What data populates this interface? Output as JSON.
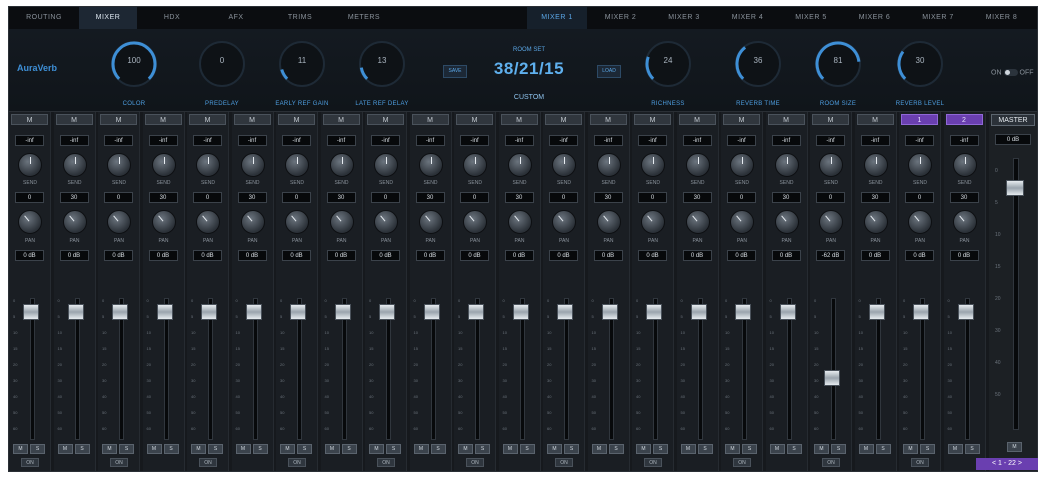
{
  "tabs": [
    "ROUTING",
    "MIXER",
    "HDX",
    "AFX",
    "TRIMS",
    "METERS"
  ],
  "active_tab": 1,
  "mixer_tabs": [
    "MIXER 1",
    "MIXER 2",
    "MIXER 3",
    "MIXER 4",
    "MIXER 5",
    "MIXER 6",
    "MIXER 7",
    "MIXER 8"
  ],
  "active_mixer_tab": 0,
  "reverb": {
    "logo": "AuraVerb",
    "knobs": [
      {
        "value": "100",
        "label": "COLOR"
      },
      {
        "value": "0",
        "label": "PREDELAY"
      },
      {
        "value": "11",
        "label": "EARLY REF GAIN"
      },
      {
        "value": "13",
        "label": "LATE REF DELAY"
      },
      {
        "value": "24",
        "label": "RICHNESS"
      },
      {
        "value": "36",
        "label": "REVERB TIME"
      },
      {
        "value": "81",
        "label": "ROOM SIZE"
      },
      {
        "value": "30",
        "label": "REVERB LEVEL"
      }
    ],
    "save_label": "SAVE",
    "load_label": "LOAD",
    "room_title": "ROOM SET",
    "room_value": "38/21/15",
    "preset": "CUSTOM",
    "onoff_on": "ON",
    "onoff_off": "OFF"
  },
  "channels": [
    {
      "header": "M",
      "level": "-inf",
      "send_label": "SEND",
      "send": "0",
      "pan_label": "PAN",
      "gain": "0 dB",
      "fader": 0.1,
      "btn1": "M",
      "btn2": "S",
      "footer": "ON"
    },
    {
      "header": "M",
      "level": "-inf",
      "send_label": "SEND",
      "send": "30",
      "pan_label": "PAN",
      "gain": "0 dB",
      "fader": 0.1,
      "btn1": "M",
      "btn2": "S",
      "footer": ""
    },
    {
      "header": "M",
      "level": "-inf",
      "send_label": "SEND",
      "send": "0",
      "pan_label": "PAN",
      "gain": "0 dB",
      "fader": 0.1,
      "btn1": "M",
      "btn2": "S",
      "footer": "ON"
    },
    {
      "header": "M",
      "level": "-inf",
      "send_label": "SEND",
      "send": "30",
      "pan_label": "PAN",
      "gain": "0 dB",
      "fader": 0.1,
      "btn1": "M",
      "btn2": "S",
      "footer": ""
    },
    {
      "header": "M",
      "level": "-inf",
      "send_label": "SEND",
      "send": "0",
      "pan_label": "PAN",
      "gain": "0 dB",
      "fader": 0.1,
      "btn1": "M",
      "btn2": "S",
      "footer": "ON"
    },
    {
      "header": "M",
      "level": "-inf",
      "send_label": "SEND",
      "send": "30",
      "pan_label": "PAN",
      "gain": "0 dB",
      "fader": 0.1,
      "btn1": "M",
      "btn2": "S",
      "footer": ""
    },
    {
      "header": "M",
      "level": "-inf",
      "send_label": "SEND",
      "send": "0",
      "pan_label": "PAN",
      "gain": "0 dB",
      "fader": 0.1,
      "btn1": "M",
      "btn2": "S",
      "footer": "ON"
    },
    {
      "header": "M",
      "level": "-inf",
      "send_label": "SEND",
      "send": "30",
      "pan_label": "PAN",
      "gain": "0 dB",
      "fader": 0.1,
      "btn1": "M",
      "btn2": "S",
      "footer": ""
    },
    {
      "header": "M",
      "level": "-inf",
      "send_label": "SEND",
      "send": "0",
      "pan_label": "PAN",
      "gain": "0 dB",
      "fader": 0.1,
      "btn1": "M",
      "btn2": "S",
      "footer": "ON"
    },
    {
      "header": "M",
      "level": "-inf",
      "send_label": "SEND",
      "send": "30",
      "pan_label": "PAN",
      "gain": "0 dB",
      "fader": 0.1,
      "btn1": "M",
      "btn2": "S",
      "footer": ""
    },
    {
      "header": "M",
      "level": "-inf",
      "send_label": "SEND",
      "send": "0",
      "pan_label": "PAN",
      "gain": "0 dB",
      "fader": 0.1,
      "btn1": "M",
      "btn2": "S",
      "footer": "ON"
    },
    {
      "header": "M",
      "level": "-inf",
      "send_label": "SEND",
      "send": "30",
      "pan_label": "PAN",
      "gain": "0 dB",
      "fader": 0.1,
      "btn1": "M",
      "btn2": "S",
      "footer": ""
    },
    {
      "header": "M",
      "level": "-inf",
      "send_label": "SEND",
      "send": "0",
      "pan_label": "PAN",
      "gain": "0 dB",
      "fader": 0.1,
      "btn1": "M",
      "btn2": "S",
      "footer": "ON"
    },
    {
      "header": "M",
      "level": "-inf",
      "send_label": "SEND",
      "send": "30",
      "pan_label": "PAN",
      "gain": "0 dB",
      "fader": 0.1,
      "btn1": "M",
      "btn2": "S",
      "footer": ""
    },
    {
      "header": "M",
      "level": "-inf",
      "send_label": "SEND",
      "send": "0",
      "pan_label": "PAN",
      "gain": "0 dB",
      "fader": 0.1,
      "btn1": "M",
      "btn2": "S",
      "footer": "ON"
    },
    {
      "header": "M",
      "level": "-inf",
      "send_label": "SEND",
      "send": "30",
      "pan_label": "PAN",
      "gain": "0 dB",
      "fader": 0.1,
      "btn1": "M",
      "btn2": "S",
      "footer": ""
    },
    {
      "header": "M",
      "level": "-inf",
      "send_label": "SEND",
      "send": "0",
      "pan_label": "PAN",
      "gain": "0 dB",
      "fader": 0.1,
      "btn1": "M",
      "btn2": "S",
      "footer": "ON"
    },
    {
      "header": "M",
      "level": "-inf",
      "send_label": "SEND",
      "send": "30",
      "pan_label": "PAN",
      "gain": "0 dB",
      "fader": 0.1,
      "btn1": "M",
      "btn2": "S",
      "footer": ""
    },
    {
      "header": "M",
      "level": "-inf",
      "send_label": "SEND",
      "send": "0",
      "pan_label": "PAN",
      "gain": "-62 dB",
      "fader": 0.57,
      "btn1": "M",
      "btn2": "S",
      "footer": "ON"
    },
    {
      "header": "M",
      "level": "-inf",
      "send_label": "SEND",
      "send": "30",
      "pan_label": "PAN",
      "gain": "0 dB",
      "fader": 0.1,
      "btn1": "M",
      "btn2": "S",
      "footer": ""
    },
    {
      "header": "1",
      "level": "-inf",
      "send_label": "SEND",
      "send": "0",
      "pan_label": "PAN",
      "gain": "0 dB",
      "fader": 0.1,
      "btn1": "M",
      "btn2": "S",
      "footer": "ON"
    },
    {
      "header": "2",
      "level": "-inf",
      "send_label": "SEND",
      "send": "30",
      "pan_label": "PAN",
      "gain": "0 dB",
      "fader": 0.1,
      "btn1": "M",
      "btn2": "S",
      "footer": ""
    }
  ],
  "scale_ticks": [
    "0",
    "5",
    "10",
    "15",
    "20",
    "30",
    "40",
    "50",
    "60"
  ],
  "master": {
    "header": "MASTER",
    "value": "0 dB",
    "fader": 0.08,
    "ticks": [
      "0",
      "5",
      "10",
      "15",
      "20",
      "30",
      "40",
      "50"
    ],
    "btn": "M"
  },
  "pager": "< 1 - 22 >",
  "colors": {
    "accent": "#5aa6e6",
    "purple": "#6a3fb0",
    "bg": "#16191d"
  }
}
